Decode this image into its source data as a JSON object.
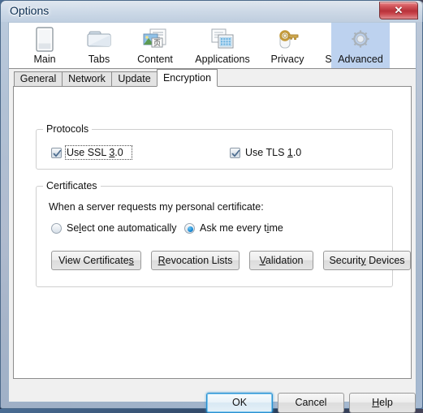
{
  "window": {
    "title": "Options",
    "close_label": "✕",
    "close_icon": "close-icon"
  },
  "toolbar": {
    "items": [
      {
        "label": "Main",
        "icon": "window-icon",
        "selected": false
      },
      {
        "label": "Tabs",
        "icon": "folder-tabs-icon",
        "selected": false
      },
      {
        "label": "Content",
        "icon": "content-page-icon",
        "selected": false
      },
      {
        "label": "Applications",
        "icon": "applications-icon",
        "selected": false
      },
      {
        "label": "Privacy",
        "icon": "key-icon",
        "selected": false
      },
      {
        "label": "Security",
        "icon": "padlock-icon",
        "selected": false
      },
      {
        "label": "Advanced",
        "icon": "gear-icon",
        "selected": true
      }
    ]
  },
  "subtabs": {
    "items": [
      {
        "label": "General",
        "selected": false
      },
      {
        "label": "Network",
        "selected": false
      },
      {
        "label": "Update",
        "selected": false
      },
      {
        "label": "Encryption",
        "selected": true
      }
    ]
  },
  "protocols": {
    "legend": "Protocols",
    "ssl": {
      "label_pre": "Use SSL ",
      "accel": "3",
      "label_post": ".0",
      "checked": true,
      "focused": true
    },
    "tls": {
      "label_pre": "Use TLS ",
      "accel": "1",
      "label_post": ".0",
      "checked": true,
      "focused": false
    }
  },
  "certificates": {
    "legend": "Certificates",
    "prompt": "When a server requests my personal certificate:",
    "radios": [
      {
        "label_pre": "Se",
        "accel": "l",
        "label_post": "ect one automatically",
        "selected": false
      },
      {
        "label_pre": "Ask me every t",
        "accel": "i",
        "label_post": "me",
        "selected": true
      }
    ],
    "buttons": [
      {
        "label_pre": "View Certificate",
        "accel": "s",
        "label_post": ""
      },
      {
        "label_pre": "",
        "accel": "R",
        "label_post": "evocation Lists"
      },
      {
        "label_pre": "",
        "accel": "V",
        "label_post": "alidation"
      },
      {
        "label_pre": "Securit",
        "accel": "y",
        "label_post": " Devices"
      }
    ]
  },
  "footer": {
    "buttons": [
      {
        "label_pre": "OK",
        "accel": "",
        "label_post": "",
        "default": true
      },
      {
        "label_pre": "Cancel",
        "accel": "",
        "label_post": "",
        "default": false
      },
      {
        "label_pre": "",
        "accel": "H",
        "label_post": "elp",
        "default": false
      }
    ]
  },
  "colors": {
    "selected_tab": "#bdd2ef",
    "default_button_border": "#2a8fd0",
    "radio_dot": "#1e90d8",
    "close_button": "#b8323a"
  }
}
